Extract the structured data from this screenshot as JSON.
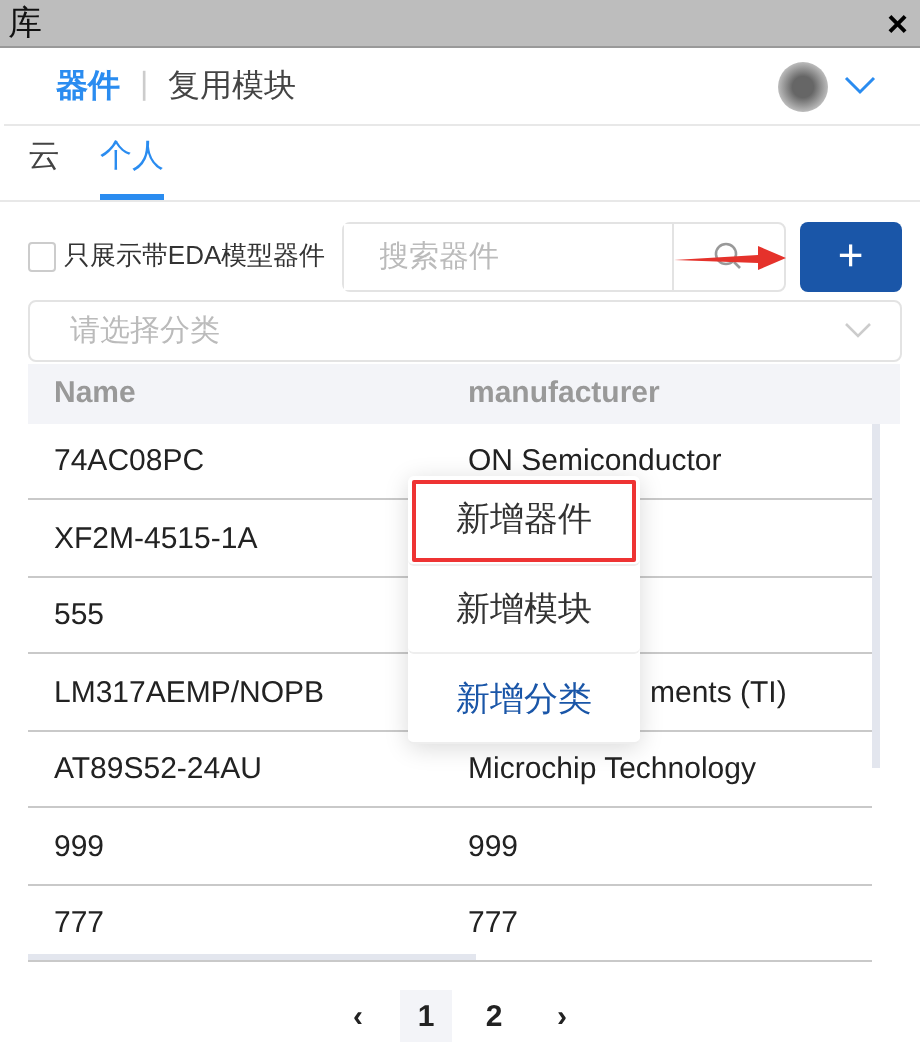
{
  "window": {
    "title": "库",
    "close": "×"
  },
  "header": {
    "tabs": [
      {
        "label": "器件",
        "selected": true
      },
      {
        "label": "复用模块",
        "selected": false
      }
    ],
    "separator": "|"
  },
  "tabs": [
    {
      "label": "云",
      "selected": false
    },
    {
      "label": "个人",
      "selected": true
    }
  ],
  "filter": {
    "checkbox": {
      "label": "只展示带EDA模型器件",
      "checked": false
    },
    "search": {
      "placeholder": "搜索器件"
    },
    "add_button": "+"
  },
  "category": {
    "placeholder": "请选择分类"
  },
  "table": {
    "columns": [
      "Name",
      "manufacturer"
    ],
    "rows": [
      {
        "name": "74AC08PC",
        "manufacturer": "ON Semiconductor"
      },
      {
        "name": "XF2M-4515-1A"
      },
      {
        "name": "555"
      },
      {
        "name": "LM317AEMP/NOPB",
        "manufacturer": "ments (TI)",
        "clipped_left": true
      },
      {
        "name": "AT89S52-24AU",
        "manufacturer": "Microchip Technology"
      },
      {
        "name": "999",
        "manufacturer": "999"
      },
      {
        "name": "777",
        "manufacturer": "777"
      }
    ]
  },
  "menu": [
    {
      "label": "新增器件",
      "kind": "normal",
      "selected": true
    },
    {
      "label": "新增模块",
      "kind": "normal",
      "selected": false
    },
    {
      "label": "新增分类",
      "kind": "accent",
      "selected": false
    }
  ],
  "pagination": {
    "prev": "‹",
    "pages": [
      {
        "label": "1",
        "selected": true
      },
      {
        "label": "2",
        "selected": false
      }
    ],
    "next": "›"
  }
}
